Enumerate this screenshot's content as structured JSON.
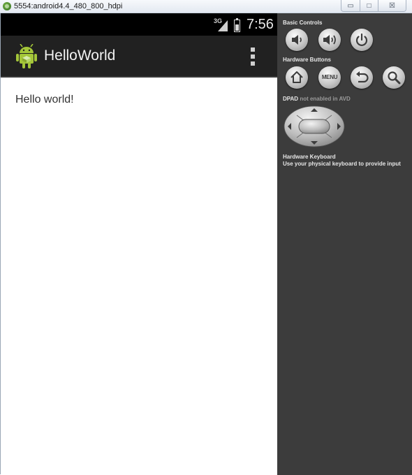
{
  "window": {
    "title": "5554:android4.4_480_800_hdpi",
    "controls": {
      "minimize": "▭",
      "maximize": "□",
      "close": "☒"
    }
  },
  "status_bar": {
    "network": "3G",
    "time": "7:56"
  },
  "action_bar": {
    "app_title": "HelloWorld",
    "icon": "android-robot-icon",
    "overflow_icon": "overflow-menu-icon"
  },
  "content": {
    "text": "Hello world!"
  },
  "emulator_panel": {
    "basic_controls": {
      "label": "Basic Controls",
      "buttons": [
        "volume-down-icon",
        "volume-up-icon",
        "power-icon"
      ]
    },
    "hardware_buttons": {
      "label": "Hardware Buttons",
      "menu_label": "MENU",
      "buttons": [
        "home-icon",
        "menu-button",
        "back-icon",
        "search-icon"
      ]
    },
    "dpad": {
      "label": "DPAD",
      "note": "not enabled in AVD"
    },
    "hardware_keyboard": {
      "label": "Hardware Keyboard",
      "description": "Use your physical keyboard to provide input"
    }
  },
  "colors": {
    "status_bar": "#000000",
    "action_bar": "#212121",
    "panel": "#3c3c3c",
    "content": "#ffffff",
    "android_green": "#a4c639"
  }
}
